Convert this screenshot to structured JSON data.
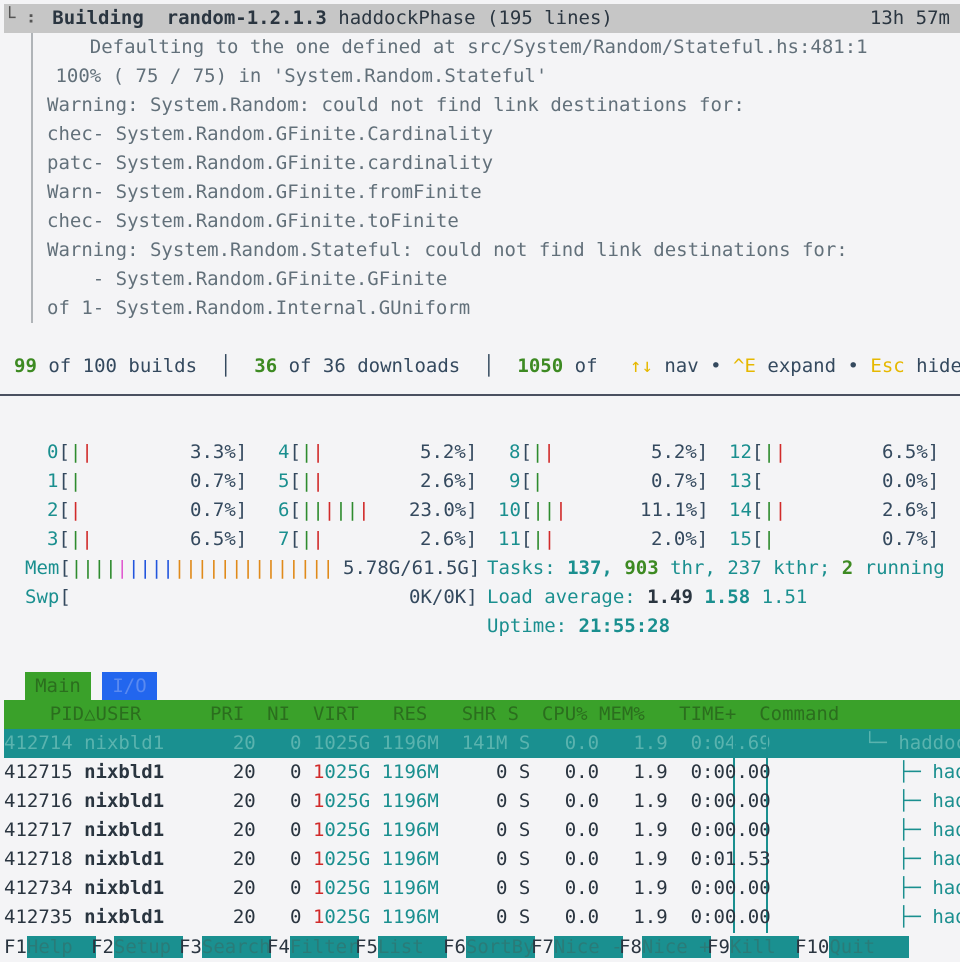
{
  "build_header": {
    "tree_prefix": "└ ⠆",
    "action": "Building",
    "package": "random-1.2.1.3",
    "phase": "haddockPhase",
    "lines": "(195 lines)",
    "elapsed": "13h 57m"
  },
  "log_lines": [
    "    Defaulting to the one defined at src/System/Random/Stateful.hs:481:1",
    " 100% ( 75 / 75) in 'System.Random.Stateful'",
    "Warning: System.Random: could not find link destinations for:",
    "chec- System.Random.GFinite.Cardinality",
    "patc- System.Random.GFinite.cardinality",
    "Warn- System.Random.GFinite.fromFinite",
    "chec- System.Random.GFinite.toFinite",
    "Warning: System.Random.Stateful: could not find link destinations for:",
    "    - System.Random.GFinite.GFinite",
    "of 1- System.Random.Internal.GUniform"
  ],
  "nom_status": {
    "builds_done": "99",
    "builds_text": "of 100 builds",
    "downloads_done": "36",
    "downloads_text": "of 36 downloads",
    "other_done": "1050",
    "other_text": "of",
    "nav_arrows": "↑↓",
    "nav_label": "nav",
    "expand_key": "^E",
    "expand_label": "expand",
    "hide_key": "Esc",
    "hide_label": "hide",
    "bullet": "•"
  },
  "cpus": [
    {
      "id": "0",
      "value": "3.3%"
    },
    {
      "id": "1",
      "value": "0.7%"
    },
    {
      "id": "2",
      "value": "0.7%"
    },
    {
      "id": "3",
      "value": "6.5%"
    },
    {
      "id": "4",
      "value": "5.2%"
    },
    {
      "id": "5",
      "value": "2.6%"
    },
    {
      "id": "6",
      "value": "23.0%"
    },
    {
      "id": "7",
      "value": "2.6%"
    },
    {
      "id": "8",
      "value": "5.2%"
    },
    {
      "id": "9",
      "value": "0.7%"
    },
    {
      "id": "10",
      "value": "11.1%"
    },
    {
      "id": "11",
      "value": "2.0%"
    },
    {
      "id": "12",
      "value": "6.5%"
    },
    {
      "id": "13",
      "value": "0.0%"
    },
    {
      "id": "14",
      "value": "2.6%"
    },
    {
      "id": "15",
      "value": "0.7%"
    }
  ],
  "memory": {
    "mem_label": "Mem",
    "mem_value": "5.78G/61.5G",
    "swp_label": "Swp",
    "swp_value": "0K/0K"
  },
  "tasks": {
    "label": "Tasks:",
    "tasks": "137,",
    "threads": "903",
    "thr_label": "thr,",
    "kthreads": "237",
    "kthr_label": "kthr;",
    "running": "2",
    "running_label": "running"
  },
  "load": {
    "label": "Load average:",
    "l1": "1.49",
    "l5": "1.58",
    "l15": "1.51"
  },
  "uptime": {
    "label": "Uptime:",
    "value": "21:55:28"
  },
  "tabs": [
    {
      "label": "Main"
    },
    {
      "label": "I/O"
    }
  ],
  "columns": {
    "pid": "PID",
    "sort_arrow": "△",
    "user": "USER",
    "pri": "PRI",
    "ni": "NI",
    "virt": "VIRT",
    "res": "RES",
    "shr": "SHR",
    "s": "S",
    "cpu": "CPU%",
    "mem": "MEM%",
    "time": "TIME+",
    "command": "Command"
  },
  "processes": [
    {
      "pid": "412714",
      "user": "nixbld1",
      "pri": "20",
      "ni": "0",
      "virt": "1025G",
      "res": "1196M",
      "shr": "141M",
      "s": "S",
      "cpu": "0.0",
      "mem": "1.9",
      "time": "0:04.69",
      "cmd": "└─ haddoc"
    },
    {
      "pid": "412715",
      "user": "nixbld1",
      "pri": "20",
      "ni": "0",
      "virt_hi": "1",
      "virt_lo": "025G",
      "res": "1196M",
      "shr": "0",
      "s": "S",
      "cpu": "0.0",
      "mem": "1.9",
      "time": "0:00.00",
      "cmd": "├─ had"
    },
    {
      "pid": "412716",
      "user": "nixbld1",
      "pri": "20",
      "ni": "0",
      "virt_hi": "1",
      "virt_lo": "025G",
      "res": "1196M",
      "shr": "0",
      "s": "S",
      "cpu": "0.0",
      "mem": "1.9",
      "time": "0:00.00",
      "cmd": "├─ had"
    },
    {
      "pid": "412717",
      "user": "nixbld1",
      "pri": "20",
      "ni": "0",
      "virt_hi": "1",
      "virt_lo": "025G",
      "res": "1196M",
      "shr": "0",
      "s": "S",
      "cpu": "0.0",
      "mem": "1.9",
      "time": "0:00.00",
      "cmd": "├─ had"
    },
    {
      "pid": "412718",
      "user": "nixbld1",
      "pri": "20",
      "ni": "0",
      "virt_hi": "1",
      "virt_lo": "025G",
      "res": "1196M",
      "shr": "0",
      "s": "S",
      "cpu": "0.0",
      "mem": "1.9",
      "time": "0:01.53",
      "cmd": "├─ had"
    },
    {
      "pid": "412734",
      "user": "nixbld1",
      "pri": "20",
      "ni": "0",
      "virt_hi": "1",
      "virt_lo": "025G",
      "res": "1196M",
      "shr": "0",
      "s": "S",
      "cpu": "0.0",
      "mem": "1.9",
      "time": "0:00.00",
      "cmd": "├─ had"
    },
    {
      "pid": "412735",
      "user": "nixbld1",
      "pri": "20",
      "ni": "0",
      "virt_hi": "1",
      "virt_lo": "025G",
      "res": "1196M",
      "shr": "0",
      "s": "S",
      "cpu": "0.0",
      "mem": "1.9",
      "time": "0:00.00",
      "cmd": "├─ had"
    }
  ],
  "function_keys": [
    {
      "key": "F1",
      "label": "Help  "
    },
    {
      "key": "F2",
      "label": "Setup "
    },
    {
      "key": "F3",
      "label": "Search"
    },
    {
      "key": "F4",
      "label": "Filter"
    },
    {
      "key": "F5",
      "label": "List  "
    },
    {
      "key": "F6",
      "label": "SortBy"
    },
    {
      "key": "F7",
      "label": "Nice -"
    },
    {
      "key": "F8",
      "label": "Nice +"
    },
    {
      "key": "F9",
      "label": "Kill  "
    },
    {
      "key": "F10",
      "label": "Quit   "
    }
  ]
}
